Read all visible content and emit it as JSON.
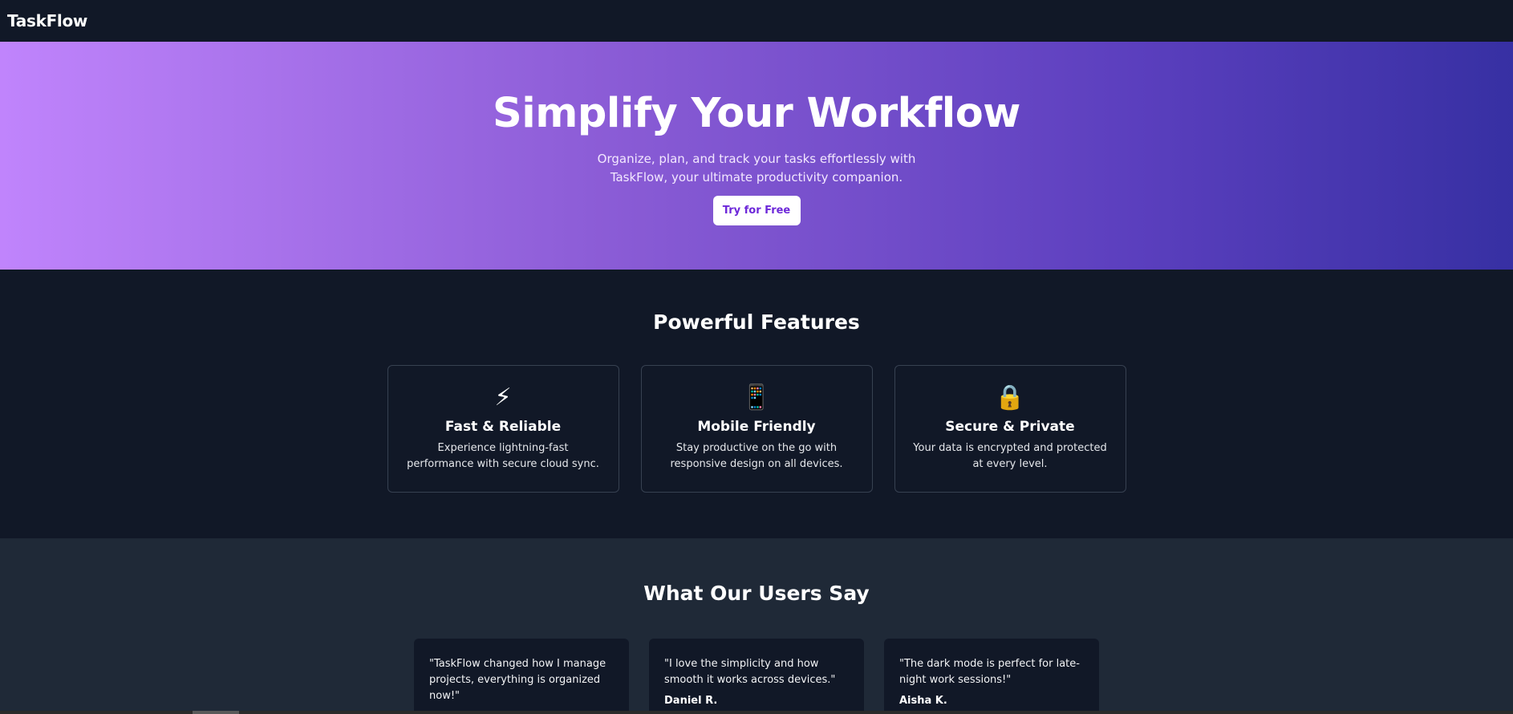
{
  "nav": {
    "logo": "TaskFlow"
  },
  "hero": {
    "title": "Simplify Your Workflow",
    "subtitle": "Organize, plan, and track your tasks effortlessly with TaskFlow, your ultimate productivity companion.",
    "cta_label": "Try for Free"
  },
  "features": {
    "heading": "Powerful Features",
    "items": [
      {
        "icon": "⚡",
        "icon_name": "lightning-icon",
        "title": "Fast & Reliable",
        "description": "Experience lightning-fast performance with secure cloud sync."
      },
      {
        "icon": "📱",
        "icon_name": "mobile-phone-icon",
        "title": "Mobile Friendly",
        "description": "Stay productive on the go with responsive design on all devices."
      },
      {
        "icon": "🔒",
        "icon_name": "lock-icon",
        "title": "Secure & Private",
        "description": "Your data is encrypted and protected at every level."
      }
    ]
  },
  "testimonials": {
    "heading": "What Our Users Say",
    "items": [
      {
        "quote": "\"TaskFlow changed how I manage projects, everything is organized now!\"",
        "author": ""
      },
      {
        "quote": "\"I love the simplicity and how smooth it works across devices.\"",
        "author": "Daniel R."
      },
      {
        "quote": "\"The dark mode is perfect for late-night work sessions!\"",
        "author": "Aisha K."
      }
    ]
  },
  "colors": {
    "page_bg": "#111827",
    "hero_gradient_start": "#c084fc",
    "hero_gradient_end": "#3730a3",
    "cta_text": "#6d28d9",
    "testimonials_bg": "#1f2937",
    "card_border": "#374151"
  }
}
